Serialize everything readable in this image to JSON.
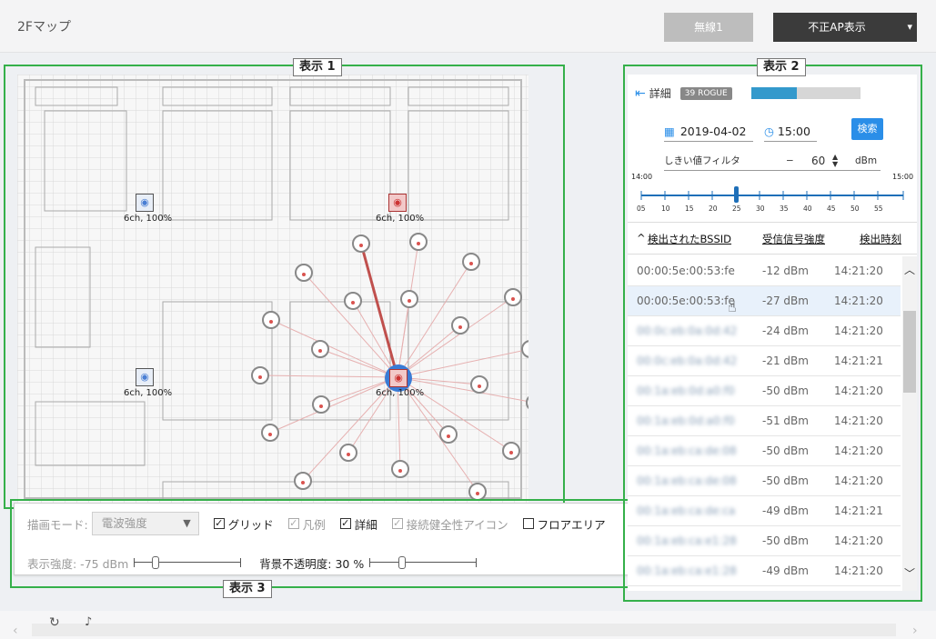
{
  "header": {
    "title": "2Fマップ",
    "wireless_button": "無線1",
    "rogue_button": "不正AP表示",
    "rogue_caret": "▾"
  },
  "tags": {
    "map": "表示 1",
    "detail": "表示 2",
    "controls": "表示 3"
  },
  "map": {
    "ap_labels": [
      "6ch, 100%",
      "6ch, 100%",
      "6ch, 100%",
      "6ch, 100%"
    ]
  },
  "controls": {
    "mode_label": "描画モード:",
    "mode_value": "電波強度",
    "grid": "グリッド",
    "legend": "凡例",
    "detail": "詳細",
    "conn_icon": "接続健全性アイコン",
    "floor_area": "フロアエリア",
    "display_strength": "表示強度: -75 dBm",
    "bg_opacity": "背景不透明度: 30 %"
  },
  "detail": {
    "back_label": "詳細",
    "badge": "39 ROGUE",
    "progress": 0.42,
    "date": "2019-04-02",
    "time": "15:00",
    "search_button": "検索",
    "threshold_label": "しきい値フィルタ",
    "threshold_minus": "−",
    "threshold_value": "60",
    "threshold_unit": "dBm",
    "time_start": "14:00",
    "time_end": "15:00",
    "ticks": [
      "05",
      "10",
      "15",
      "20",
      "25",
      "30",
      "35",
      "40",
      "45",
      "50",
      "55"
    ],
    "columns": {
      "sort_icon": "^",
      "bssid": "検出されたBSSID",
      "rssi": "受信信号強度",
      "time": "検出時刻"
    },
    "rows": [
      {
        "bssid": "00:00:5e:00:53:fe",
        "rssi": "-12 dBm",
        "time": "14:21:20",
        "blur": false
      },
      {
        "bssid": "00:00:5e:00:53:fe",
        "rssi": "-27 dBm",
        "time": "14:21:20",
        "blur": false
      },
      {
        "bssid": "00:0c:eb:0a:0d:42",
        "rssi": "-24 dBm",
        "time": "14:21:20",
        "blur": true
      },
      {
        "bssid": "00:0c:eb:0a:0d:42",
        "rssi": "-21 dBm",
        "time": "14:21:21",
        "blur": true
      },
      {
        "bssid": "00:1a:eb:0d:a0:f0",
        "rssi": "-50 dBm",
        "time": "14:21:20",
        "blur": true
      },
      {
        "bssid": "00:1a:eb:0d:a0:f0",
        "rssi": "-51 dBm",
        "time": "14:21:20",
        "blur": true
      },
      {
        "bssid": "00:1a:eb:ca:de:08",
        "rssi": "-50 dBm",
        "time": "14:21:20",
        "blur": true
      },
      {
        "bssid": "00:1a:eb:ca:de:08",
        "rssi": "-50 dBm",
        "time": "14:21:20",
        "blur": true
      },
      {
        "bssid": "00:1a:eb:ca:de:ca",
        "rssi": "-49 dBm",
        "time": "14:21:21",
        "blur": true
      },
      {
        "bssid": "00:1a:eb:ca:e1:28",
        "rssi": "-50 dBm",
        "time": "14:21:20",
        "blur": true
      },
      {
        "bssid": "00:1a:eb:ca:e1:28",
        "rssi": "-49 dBm",
        "time": "14:21:20",
        "blur": true
      }
    ]
  }
}
